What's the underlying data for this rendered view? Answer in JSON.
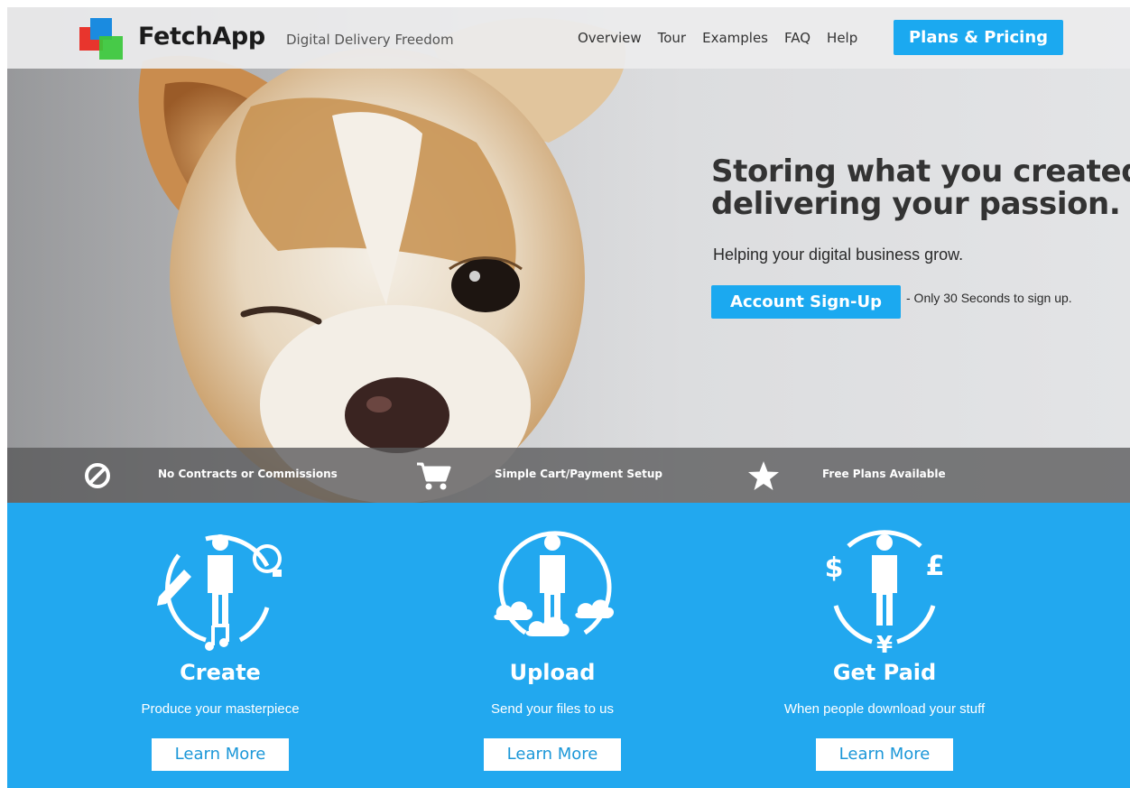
{
  "header": {
    "brand_name": "FetchApp",
    "tagline": "Digital Delivery Freedom",
    "nav": [
      "Overview",
      "Tour",
      "Examples",
      "FAQ",
      "Help"
    ],
    "plans_button": "Plans & Pricing",
    "logo_colors": [
      "#e8352d",
      "#1a8be0",
      "#3ac83a"
    ]
  },
  "hero": {
    "title_line1": "Storing what you created,",
    "title_line2": "delivering your passion.",
    "subtitle": "Helping your digital business grow.",
    "signup_button": "Account Sign-Up",
    "signup_note": "- Only 30 Seconds to sign up."
  },
  "features": [
    {
      "icon": "no-sign-icon",
      "label": "No Contracts or Commissions"
    },
    {
      "icon": "shopping-cart-icon",
      "label": "Simple Cart/Payment Setup"
    },
    {
      "icon": "star-icon",
      "label": "Free Plans Available"
    }
  ],
  "steps": [
    {
      "icon": "create-person-icon",
      "title": "Create",
      "subtitle": "Produce your masterpiece",
      "button": "Learn More"
    },
    {
      "icon": "upload-person-icon",
      "title": "Upload",
      "subtitle": "Send your files to us",
      "button": "Learn More"
    },
    {
      "icon": "paid-person-icon",
      "title": "Get Paid",
      "subtitle": "When people download your stuff",
      "button": "Learn More"
    }
  ],
  "colors": {
    "accent": "#1ba9f0",
    "steps_background": "#22a8ef",
    "feature_strip": "#58585a"
  }
}
